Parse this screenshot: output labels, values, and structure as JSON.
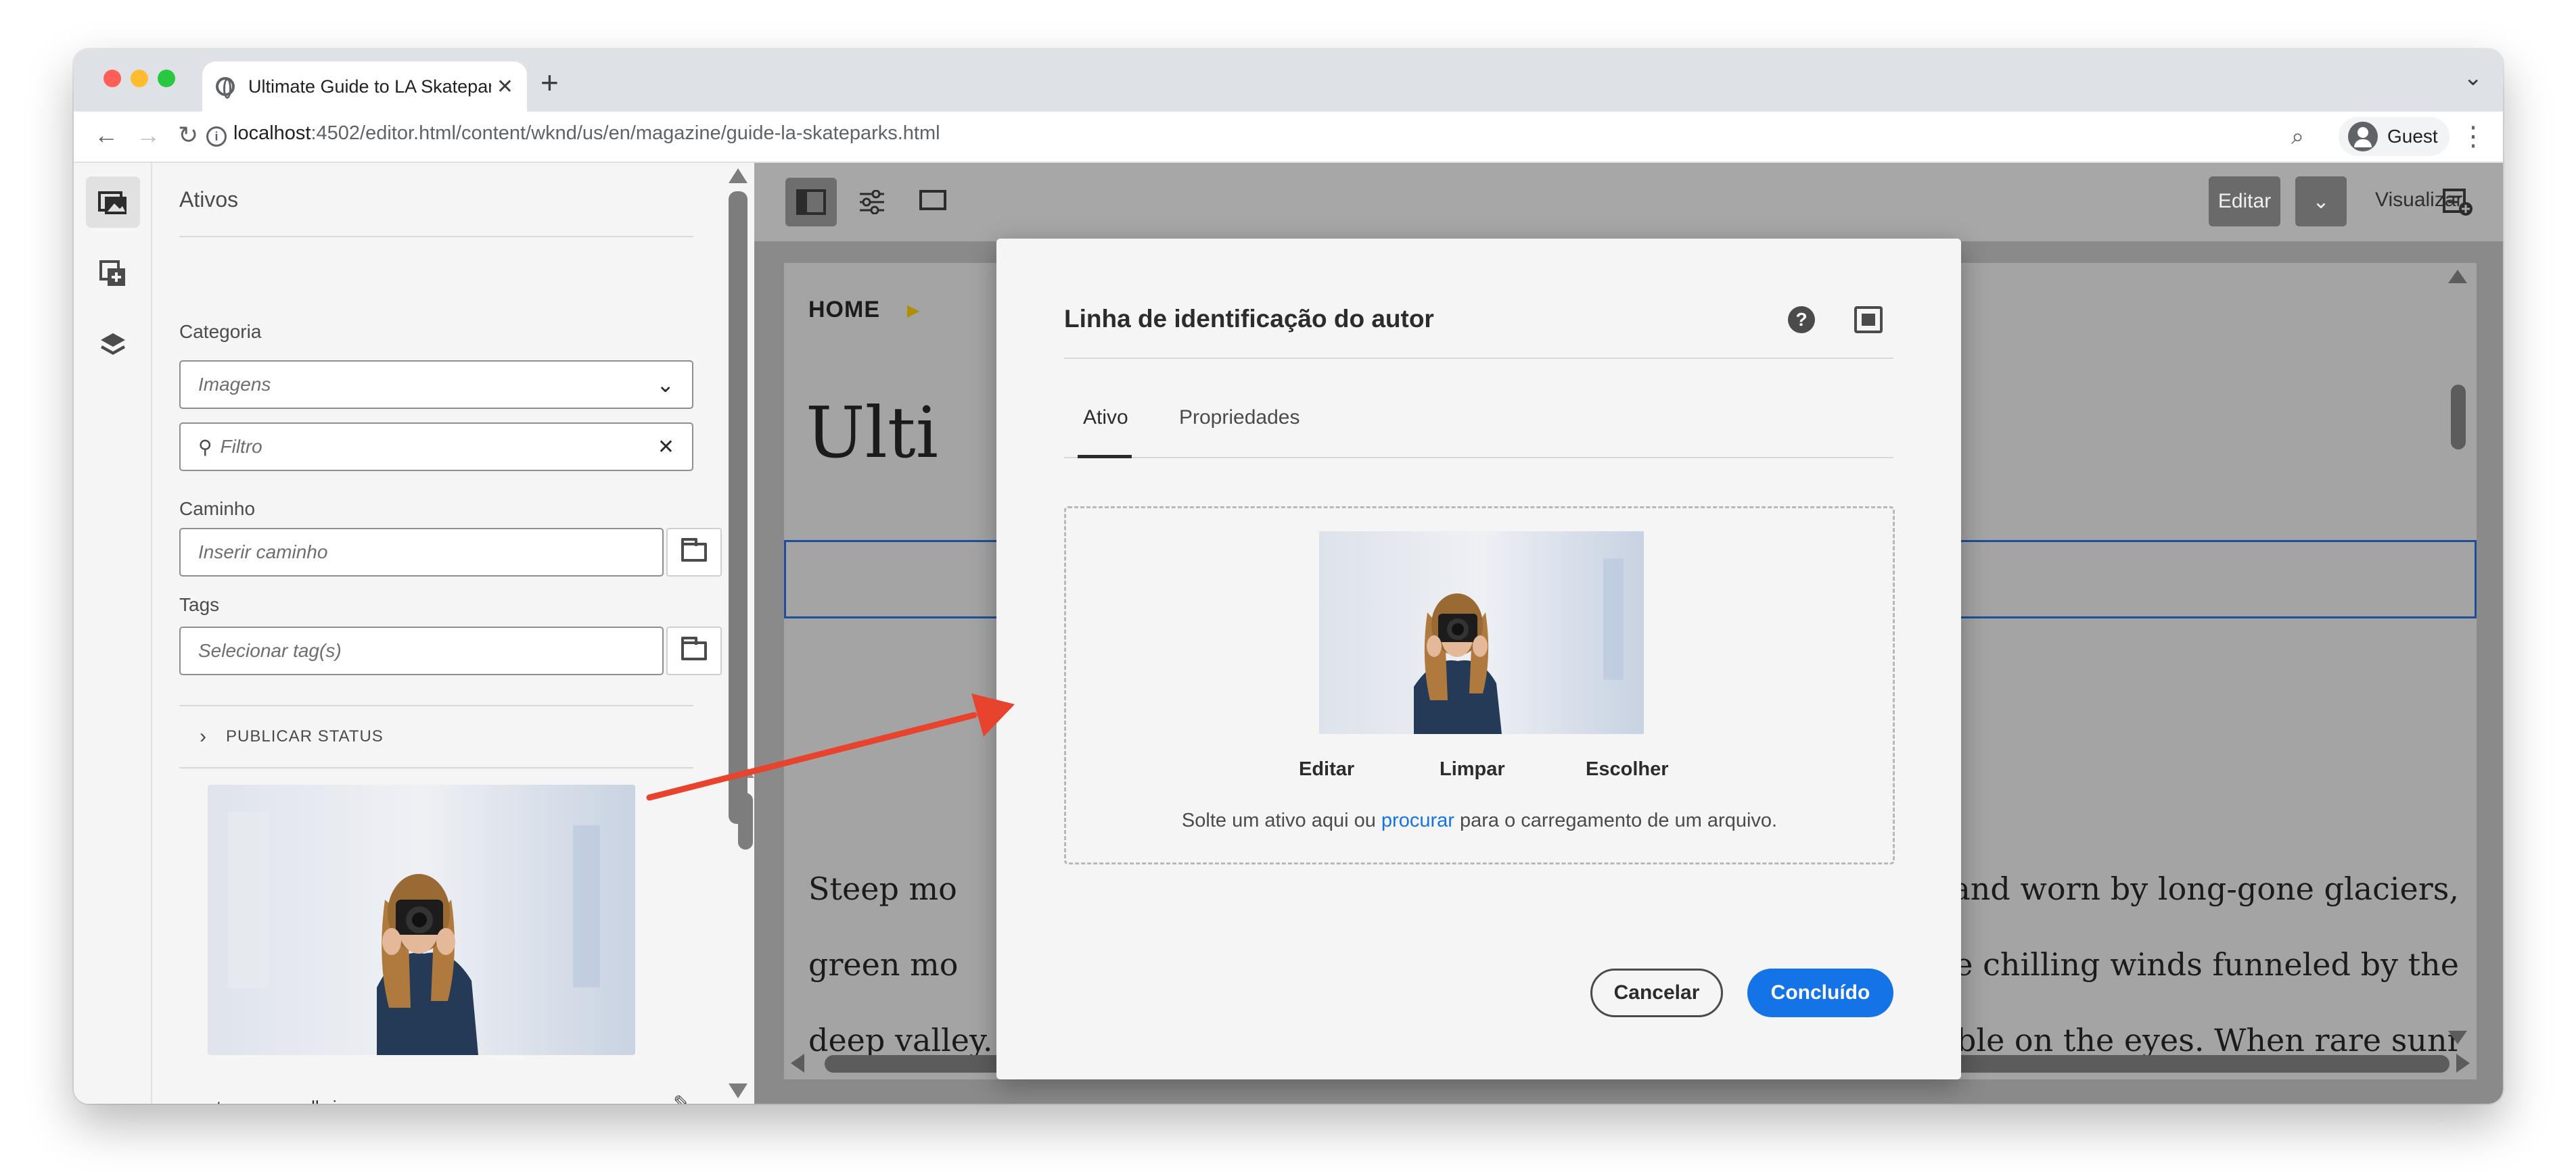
{
  "browser": {
    "tab_title": "Ultimate Guide to LA Skateparks",
    "tab_close": "✕",
    "new_tab": "+",
    "url_host": "localhost",
    "url_rest": ":4502/editor.html/content/wknd/us/en/magazine/guide-la-skateparks.html",
    "profile_label": "Guest",
    "colors": {
      "close": "#ff5f57",
      "minimize": "#febc2e",
      "maximize": "#28c840"
    }
  },
  "rail": {
    "items": [
      {
        "icon": "assets-icon"
      },
      {
        "icon": "components-icon"
      },
      {
        "icon": "layers-icon"
      }
    ]
  },
  "side_panel": {
    "title": "Ativos",
    "category_label": "Categoria",
    "category_value": "Imagens",
    "filter_placeholder": "Filtro",
    "path_label": "Caminho",
    "path_placeholder": "Inserir caminho",
    "tags_label": "Tags",
    "tags_placeholder": "Selecionar tag(s)",
    "publish_status": "PUBLICAR STATUS",
    "asset_name": "stacey-roswells.jpg"
  },
  "editor": {
    "mode_label": "Editar",
    "preview_label": "Visualizar",
    "breadcrumb": "HOME",
    "page_title_fragment": "Ulti",
    "article_lines": [
      "Steep mo",
      "hered and worn by long-gone glaciers,",
      "green mo",
      "fying the chilling winds funneled by the",
      "deep valley. The subtle hues of the arctic circle are welcoming, comfortable on the eyes. When rare sunrays pierce"
    ]
  },
  "dialog": {
    "title": "Linha de identificação do autor",
    "tabs": [
      "Ativo",
      "Propriedades"
    ],
    "active_tab": "Ativo",
    "actions": [
      "Editar",
      "Limpar",
      "Escolher"
    ],
    "drop_text_before": "Solte um ativo aqui ou ",
    "drop_link": "procurar",
    "drop_text_after": " para o carregamento de um arquivo.",
    "cancel_label": "Cancelar",
    "done_label": "Concluído",
    "accent": "#1473e6"
  },
  "annotation": {
    "arrow_color": "#e8432c"
  }
}
